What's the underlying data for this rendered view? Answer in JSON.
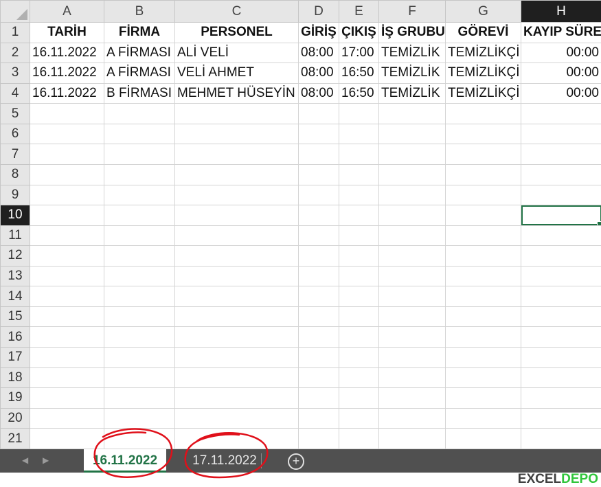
{
  "grid": {
    "columns": [
      "A",
      "B",
      "C",
      "D",
      "E",
      "F",
      "G",
      "H"
    ],
    "header_row": [
      "TARİH",
      "FİRMA",
      "PERSONEL",
      "GİRİŞ",
      "ÇIKIŞ",
      "İŞ GRUBU",
      "GÖREVİ",
      "KAYIP SÜRE"
    ],
    "rows": [
      [
        "16.11.2022",
        "A FİRMASI",
        "ALİ VELİ",
        "08:00",
        "17:00",
        "TEMİZLİK",
        "TEMİZLİKÇİ",
        "00:00"
      ],
      [
        "16.11.2022",
        "A FİRMASI",
        "VELİ AHMET",
        "08:00",
        "16:50",
        "TEMİZLİK",
        "TEMİZLİKÇİ",
        "00:00"
      ],
      [
        "16.11.2022",
        "B FİRMASI",
        "MEHMET HÜSEYİN",
        "08:00",
        "16:50",
        "TEMİZLİK",
        "TEMİZLİKÇİ",
        "00:00"
      ]
    ],
    "row_numbers": [
      "1",
      "2",
      "3",
      "4",
      "5",
      "6",
      "7",
      "8",
      "9",
      "10",
      "11",
      "12",
      "13",
      "14",
      "15",
      "16",
      "17",
      "18",
      "19",
      "20",
      "21"
    ],
    "active_column": "H",
    "active_row": "10"
  },
  "tabs": [
    {
      "label": "16.11.2022",
      "active": true
    },
    {
      "label": "17.11.2022",
      "active": false
    }
  ],
  "tabbar": {
    "add_symbol": "+",
    "prev_symbol": "◀",
    "next_symbol": "▶"
  },
  "logo": {
    "part1": "EXCEL",
    "part2": "DEPO"
  },
  "colors": {
    "accent": "#217346",
    "annotation": "#e0101a",
    "logo_green": "#2fc53a"
  }
}
